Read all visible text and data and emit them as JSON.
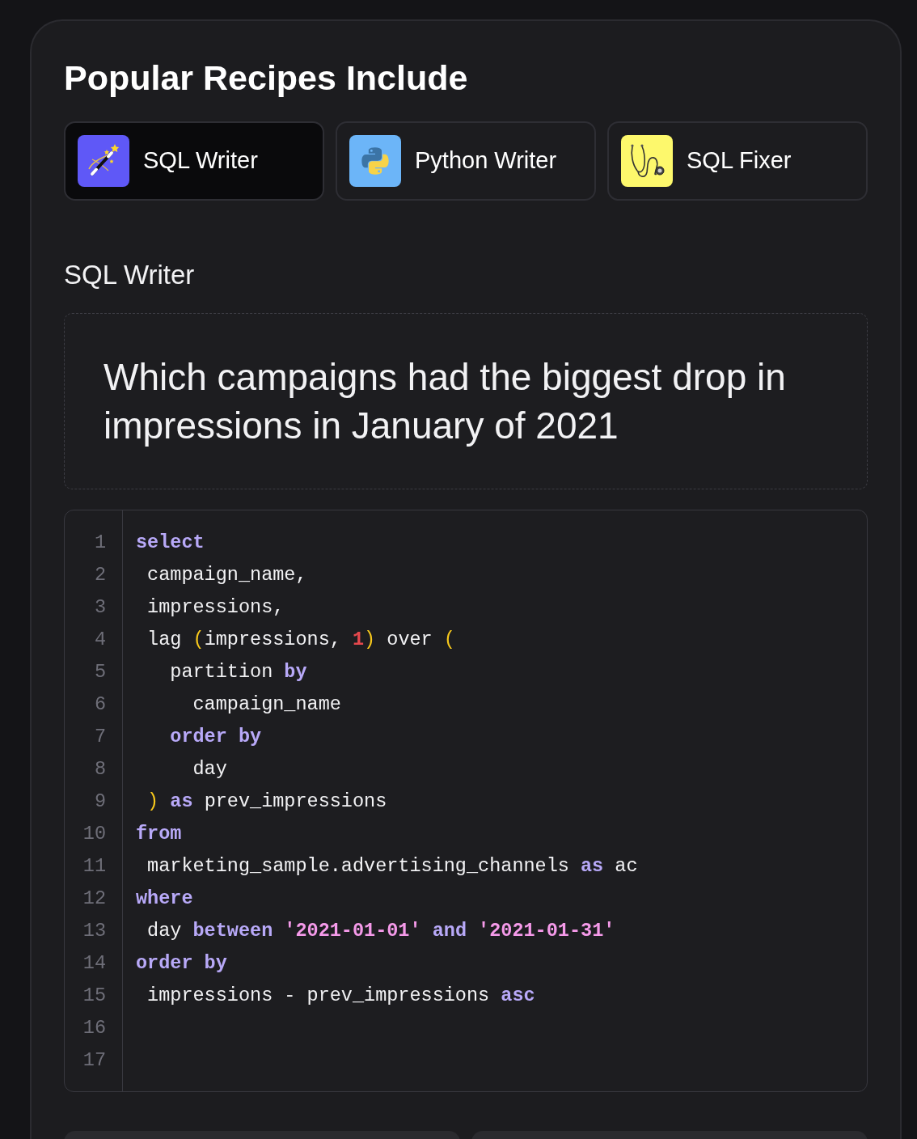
{
  "panel": {
    "title": "Popular Recipes Include"
  },
  "tabs": [
    {
      "label": "SQL Writer",
      "selected": true,
      "color": "#5f58f7"
    },
    {
      "label": "Python Writer",
      "selected": false,
      "color": "#6cb5f8"
    },
    {
      "label": "SQL Fixer",
      "selected": false,
      "color": "#fdf86c"
    }
  ],
  "recipe": {
    "heading": "SQL Writer",
    "prompt": "Which campaigns had the biggest drop in impressions in January of 2021"
  },
  "code": {
    "lines": [
      {
        "number": "1",
        "tokens": [
          {
            "text": "select",
            "kind": "keyword"
          }
        ]
      },
      {
        "number": "2",
        "tokens": [
          {
            "text": " campaign_name,",
            "kind": "plain"
          }
        ]
      },
      {
        "number": "3",
        "tokens": [
          {
            "text": " impressions,",
            "kind": "plain"
          }
        ]
      },
      {
        "number": "4",
        "tokens": [
          {
            "text": " lag ",
            "kind": "plain"
          },
          {
            "text": "(",
            "kind": "paren"
          },
          {
            "text": "impressions, ",
            "kind": "plain"
          },
          {
            "text": "1",
            "kind": "number"
          },
          {
            "text": ")",
            "kind": "paren"
          },
          {
            "text": " over ",
            "kind": "plain"
          },
          {
            "text": "(",
            "kind": "paren"
          }
        ]
      },
      {
        "number": "5",
        "tokens": [
          {
            "text": "   partition ",
            "kind": "plain"
          },
          {
            "text": "by",
            "kind": "keyword"
          }
        ]
      },
      {
        "number": "6",
        "tokens": [
          {
            "text": "     campaign_name",
            "kind": "plain"
          }
        ]
      },
      {
        "number": "7",
        "tokens": [
          {
            "text": "   order by",
            "kind": "keyword"
          }
        ]
      },
      {
        "number": "8",
        "tokens": [
          {
            "text": "     day",
            "kind": "plain"
          }
        ]
      },
      {
        "number": "9",
        "tokens": [
          {
            "text": " )",
            "kind": "paren"
          },
          {
            "text": " as",
            "kind": "keyword"
          },
          {
            "text": " prev_impressions",
            "kind": "plain"
          }
        ]
      },
      {
        "number": "10",
        "tokens": [
          {
            "text": "from",
            "kind": "keyword"
          }
        ]
      },
      {
        "number": "11",
        "tokens": [
          {
            "text": " marketing_sample.advertising_channels ",
            "kind": "plain"
          },
          {
            "text": "as",
            "kind": "keyword"
          },
          {
            "text": " ac",
            "kind": "plain"
          }
        ]
      },
      {
        "number": "12",
        "tokens": [
          {
            "text": "where",
            "kind": "keyword"
          }
        ]
      },
      {
        "number": "13",
        "tokens": [
          {
            "text": " day ",
            "kind": "plain"
          },
          {
            "text": "between",
            "kind": "keyword"
          },
          {
            "text": " '2021-01-01'",
            "kind": "string"
          },
          {
            "text": " and",
            "kind": "keyword"
          },
          {
            "text": " '2021-01-31'",
            "kind": "string"
          }
        ]
      },
      {
        "number": "14",
        "tokens": [
          {
            "text": "order by",
            "kind": "keyword"
          }
        ]
      },
      {
        "number": "15",
        "tokens": [
          {
            "text": " impressions - prev_impressions ",
            "kind": "plain"
          },
          {
            "text": "asc",
            "kind": "keyword"
          }
        ]
      },
      {
        "number": "16"
      },
      {
        "number": "17"
      }
    ]
  }
}
